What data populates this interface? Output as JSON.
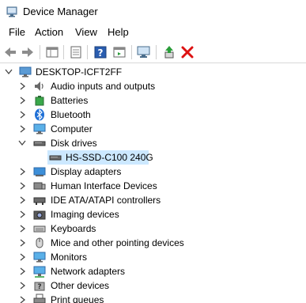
{
  "window": {
    "title": "Device Manager"
  },
  "menu": {
    "file": "File",
    "action": "Action",
    "view": "View",
    "help": "Help"
  },
  "tree": {
    "root": "DESKTOP-ICFT2FF",
    "categories": {
      "audio": "Audio inputs and outputs",
      "batteries": "Batteries",
      "bluetooth": "Bluetooth",
      "computer": "Computer",
      "disk": "Disk drives",
      "disk_child": "HS-SSD-C100 240G",
      "display": "Display adapters",
      "hid": "Human Interface Devices",
      "ide": "IDE ATA/ATAPI controllers",
      "imaging": "Imaging devices",
      "keyboards": "Keyboards",
      "mice": "Mice and other pointing devices",
      "monitors": "Monitors",
      "network": "Network adapters",
      "other": "Other devices",
      "print": "Print queues"
    }
  },
  "colors": {
    "selection": "#cce8ff",
    "icon_blue": "#1e7bd6",
    "delete_red": "#d11"
  }
}
